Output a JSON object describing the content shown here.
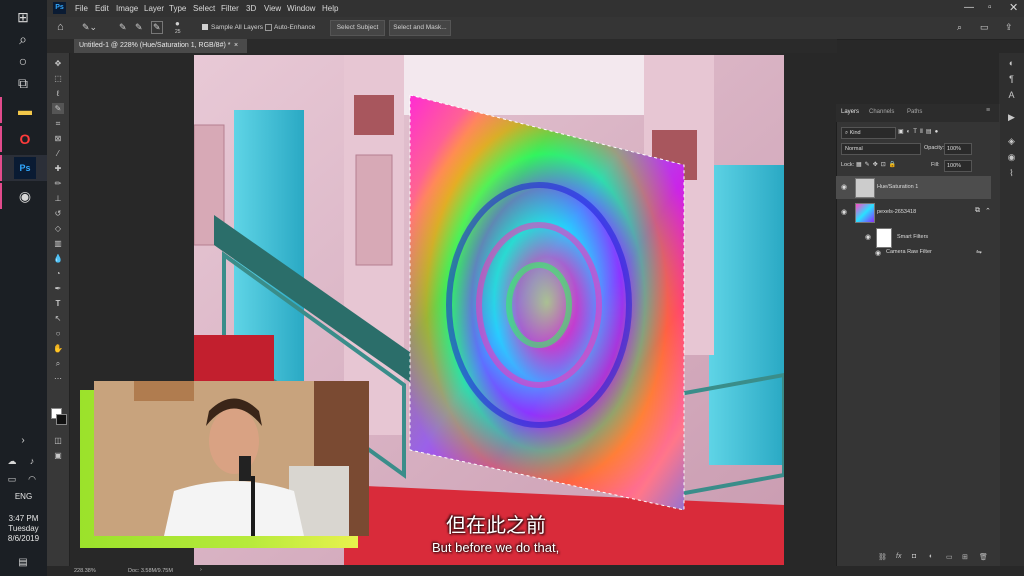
{
  "menubar": {
    "app_icon": "Ps",
    "items": [
      "File",
      "Edit",
      "Image",
      "Layer",
      "Type",
      "Select",
      "Filter",
      "3D",
      "View",
      "Window",
      "Help"
    ]
  },
  "options": {
    "brush_size": "25",
    "sample_all_layers": "Sample All Layers",
    "auto_enhance": "Auto-Enhance",
    "select_subject": "Select Subject",
    "select_and_mask": "Select and Mask..."
  },
  "document": {
    "tab_title": "Untitled-1 @ 228% (Hue/Saturation 1, RGB/8#) *",
    "zoom": "228.38%",
    "doc_size": "Doc: 3.58M/9.75M"
  },
  "layers_panel": {
    "tabs": [
      "Layers",
      "Channels",
      "Paths"
    ],
    "filter_kind": "Kind",
    "blend_mode": "Normal",
    "opacity_label": "Opacity:",
    "opacity_value": "100%",
    "lock_label": "Lock:",
    "fill_label": "Fill:",
    "fill_value": "100%",
    "layers": [
      {
        "name": "Hue/Saturation 1"
      },
      {
        "name": "pexels-2653418"
      }
    ],
    "smart_filters": "Smart Filters",
    "camera_raw": "Camera Raw Filter"
  },
  "taskbar": {
    "language": "ENG",
    "time": "3:47 PM",
    "day": "Tuesday",
    "date": "8/6/2019"
  },
  "subtitles": {
    "chinese": "但在此之前",
    "english": "But before we do that,"
  },
  "colors": {
    "accent_pink": "#e24b8c",
    "webcam_frame": "#9be22b",
    "panel_bg": "#353535"
  }
}
